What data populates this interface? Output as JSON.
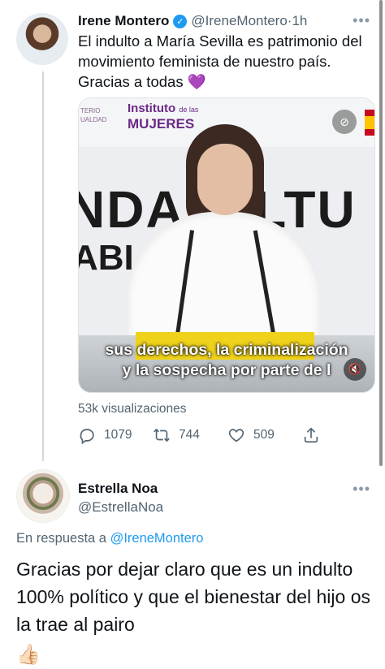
{
  "tweet": {
    "author_name": "Irene Montero",
    "verified_mark": "✓",
    "handle": "@IreneMontero",
    "separator": " · ",
    "time": "1h",
    "more_icon": "more-dots-icon",
    "text": "El indulto a María Sevilla es patrimonio del movimiento feminista de nuestro país. Gracias a todas",
    "emoji": "💜",
    "media": {
      "logo_small": "TERIO\nUALDAD",
      "logo_line1": "Instituto",
      "logo_line1_suffix": "de las",
      "logo_line2": "MUJERES",
      "backdrop_text_1": "NDA  ULTU",
      "backdrop_text_2": "ABI              2",
      "subtitle_line1": "sus derechos, la criminalización",
      "subtitle_line2": "y la sospecha por parte de l"
    },
    "views": "53k visualizaciones",
    "counts": {
      "replies": "1079",
      "retweets": "744",
      "likes": "509"
    }
  },
  "reply": {
    "author_name": "Estrella Noa",
    "handle": "@EstrellaNoa",
    "in_reply_prefix": "En respuesta a ",
    "in_reply_mention": "@IreneMontero",
    "text": "Gracias por dejar claro que es un indulto 100% político y que el bienestar del hijo os la trae al pairo",
    "emoji": "👍🏻"
  },
  "colors": {
    "accent": "#1d9bf0",
    "secondary_text": "#536471",
    "primary_text": "#0f1419",
    "heart": "#9b4de0"
  }
}
